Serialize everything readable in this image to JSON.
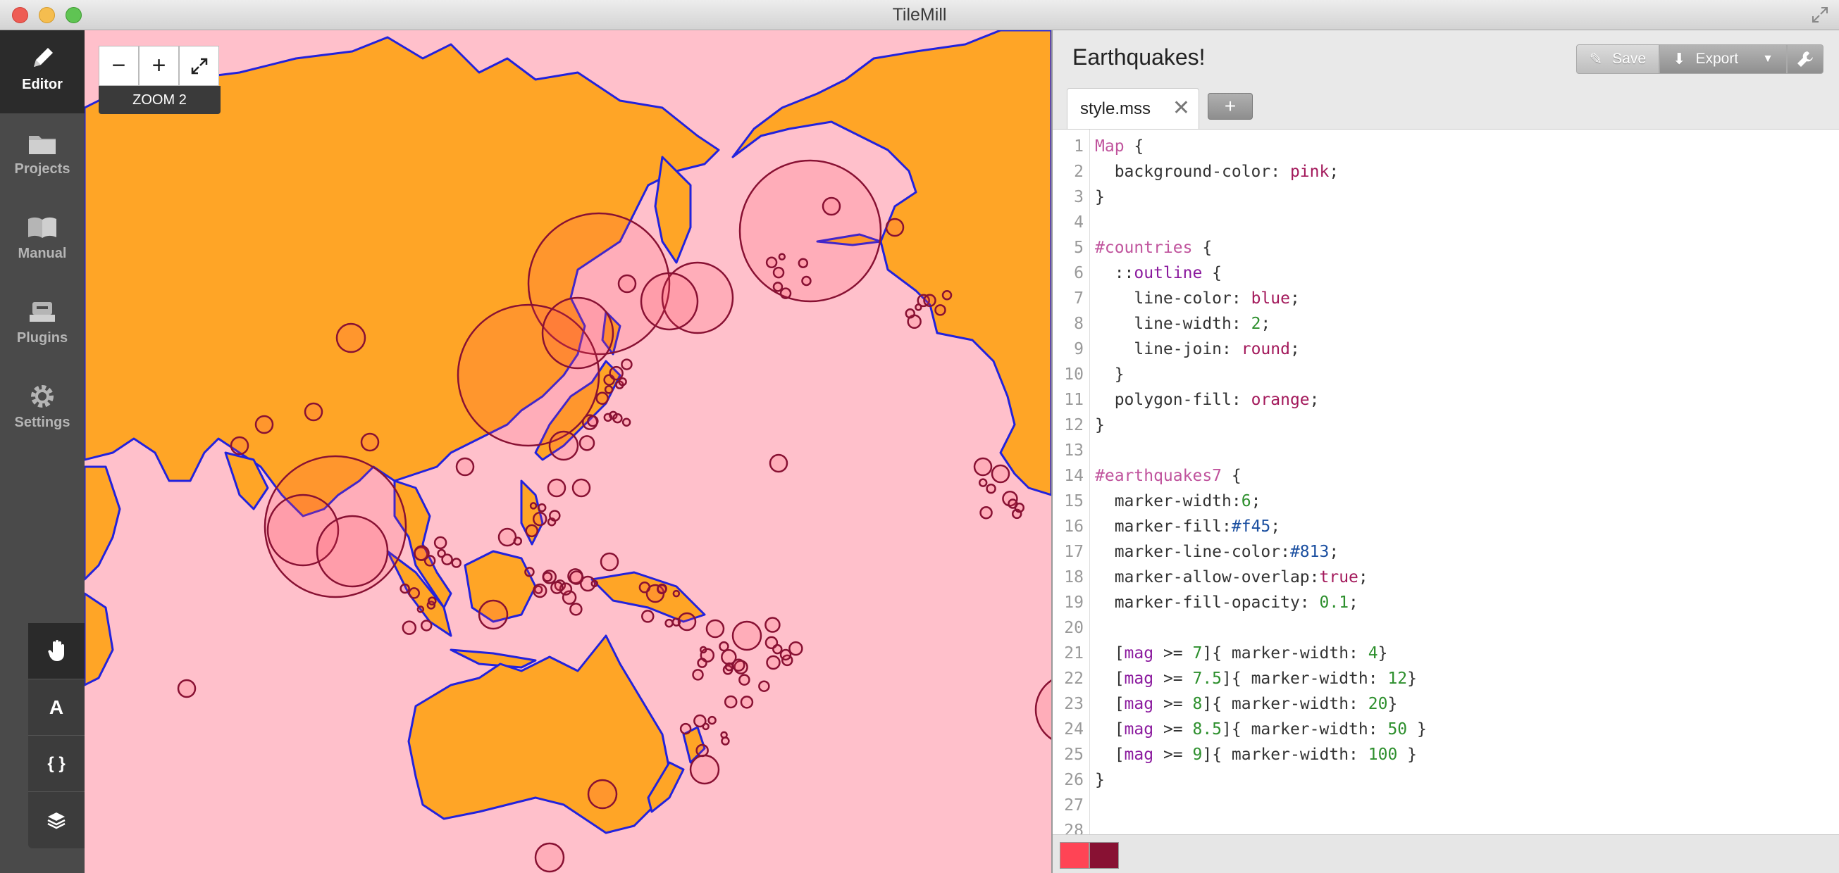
{
  "window": {
    "title": "TileMill"
  },
  "sidebar": {
    "items": [
      {
        "label": "Editor",
        "icon": "pencil-icon",
        "active": true
      },
      {
        "label": "Projects",
        "icon": "folder-icon"
      },
      {
        "label": "Manual",
        "icon": "book-icon"
      },
      {
        "label": "Plugins",
        "icon": "plugin-icon"
      },
      {
        "label": "Settings",
        "icon": "gear-icon"
      }
    ]
  },
  "tools": [
    {
      "label": "",
      "icon": "hand-icon"
    },
    {
      "label": "A",
      "icon": "text-icon"
    },
    {
      "label": "{ }",
      "icon": "braces-icon"
    },
    {
      "label": "",
      "icon": "layers-icon"
    }
  ],
  "map": {
    "zoom_label": "ZOOM 2",
    "zoom_out": "−",
    "zoom_in": "+",
    "background_color": "#ffc0cb",
    "land_color": "#ffa526",
    "outline_color": "#2222dd",
    "marker_fill": "#ff4455",
    "marker_line": "#881133"
  },
  "editor": {
    "project_title": "Earthquakes!",
    "save_label": "Save",
    "export_label": "Export",
    "tab_label": "style.mss",
    "add_tab": "+",
    "swatches": [
      "#ff4455",
      "#881133"
    ],
    "code_lines": [
      "Map {",
      "  background-color: pink;",
      "}",
      "",
      "#countries {",
      "  ::outline {",
      "    line-color: blue;",
      "    line-width: 2;",
      "    line-join: round;",
      "  }",
      "  polygon-fill: orange;",
      "}",
      "",
      "#earthquakes7 {",
      "  marker-width:6;",
      "  marker-fill:#f45;",
      "  marker-line-color:#813;",
      "  marker-allow-overlap:true;",
      "  marker-fill-opacity: 0.1;",
      "",
      "  [mag >= 7]{ marker-width: 4}",
      "  [mag >= 7.5]{ marker-width: 12}",
      "  [mag >= 8]{ marker-width: 20}",
      "  [mag >= 8.5]{ marker-width: 50 }",
      "  [mag >= 9]{ marker-width: 100 }",
      "}",
      "",
      ""
    ]
  }
}
